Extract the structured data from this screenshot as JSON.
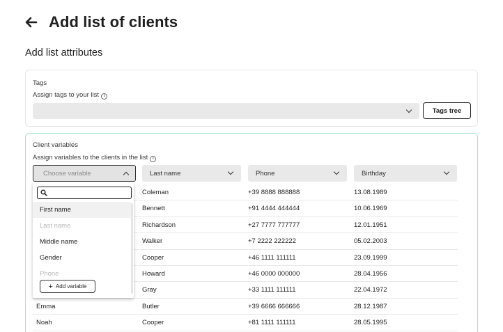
{
  "header": {
    "title": "Add list of clients",
    "back_icon": "arrow-left-icon"
  },
  "section_title": "Add list attributes",
  "tags": {
    "label": "Tags",
    "hint": "Assign tags to your list",
    "select_value": "",
    "tags_tree_label": "Tags tree"
  },
  "variables": {
    "label": "Client variables",
    "hint": "Assign variables to the clients in the list",
    "columns": [
      {
        "label": "Choose variable",
        "active": true
      },
      {
        "label": "Last name",
        "active": false
      },
      {
        "label": "Phone",
        "active": false
      },
      {
        "label": "Birthday",
        "active": false
      }
    ],
    "dropdown": {
      "search_placeholder": "",
      "items": [
        {
          "label": "First name",
          "state": "highlighted"
        },
        {
          "label": "Last name",
          "state": "disabled"
        },
        {
          "label": "Middle name",
          "state": "normal"
        },
        {
          "label": "Gender",
          "state": "normal"
        },
        {
          "label": "Phone",
          "state": "disabled"
        }
      ],
      "add_variable_label": "Add variable"
    },
    "rows": [
      {
        "first": "",
        "last": "Coleman",
        "phone": "+39 8888 888888",
        "birthday": "13.08.1989"
      },
      {
        "first": "",
        "last": "Bennett",
        "phone": "+91 4444 444444",
        "birthday": "10.06.1969"
      },
      {
        "first": "",
        "last": "Richardson",
        "phone": "+27 7777 777777",
        "birthday": "12.01.1951"
      },
      {
        "first": "",
        "last": "Walker",
        "phone": "+7 2222 222222",
        "birthday": "05.02.2003"
      },
      {
        "first": "",
        "last": "Cooper",
        "phone": "+46 1111 111111",
        "birthday": "23.09.1999"
      },
      {
        "first": "",
        "last": "Howard",
        "phone": "+46 0000 000000",
        "birthday": "28.04.1956"
      },
      {
        "first": "",
        "last": "Gray",
        "phone": "+33 1111 111111",
        "birthday": "22.04.1972"
      },
      {
        "first": "Emma",
        "last": "Butler",
        "phone": "+39 6666 666666",
        "birthday": "28.12.1987"
      },
      {
        "first": "Noah",
        "last": "Cooper",
        "phone": "+81 1111 111111",
        "birthday": "28.05.1995"
      }
    ]
  },
  "colors": {
    "accent_border": "#a6e3cf",
    "select_bg": "#e9e9e9",
    "text": "#1f1f1f"
  }
}
